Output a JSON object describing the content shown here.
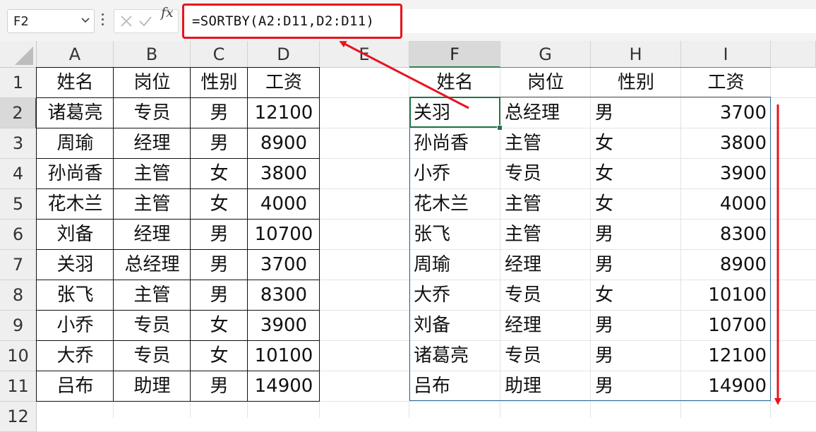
{
  "formula_bar": {
    "name_box": "F2",
    "fx_label": "fx",
    "formula": "=SORTBY(A2:D11,D2:D11)"
  },
  "columns": [
    "A",
    "B",
    "C",
    "D",
    "E",
    "F",
    "G",
    "H",
    "I"
  ],
  "rows": [
    "1",
    "2",
    "3",
    "4",
    "5",
    "6",
    "7",
    "8",
    "9",
    "10",
    "11",
    "12"
  ],
  "source_table": {
    "headers": [
      "姓名",
      "岗位",
      "性别",
      "工资"
    ],
    "rows": [
      [
        "诸葛亮",
        "专员",
        "男",
        "12100"
      ],
      [
        "周瑜",
        "经理",
        "男",
        "8900"
      ],
      [
        "孙尚香",
        "主管",
        "女",
        "3800"
      ],
      [
        "花木兰",
        "主管",
        "女",
        "4000"
      ],
      [
        "刘备",
        "经理",
        "男",
        "10700"
      ],
      [
        "关羽",
        "总经理",
        "男",
        "3700"
      ],
      [
        "张飞",
        "主管",
        "男",
        "8300"
      ],
      [
        "小乔",
        "专员",
        "女",
        "3900"
      ],
      [
        "大乔",
        "专员",
        "女",
        "10100"
      ],
      [
        "吕布",
        "助理",
        "男",
        "14900"
      ]
    ]
  },
  "sorted_table": {
    "headers": [
      "姓名",
      "岗位",
      "性别",
      "工资"
    ],
    "rows": [
      [
        "关羽",
        "总经理",
        "男",
        "3700"
      ],
      [
        "孙尚香",
        "主管",
        "女",
        "3800"
      ],
      [
        "小乔",
        "专员",
        "女",
        "3900"
      ],
      [
        "花木兰",
        "主管",
        "女",
        "4000"
      ],
      [
        "张飞",
        "主管",
        "男",
        "8300"
      ],
      [
        "周瑜",
        "经理",
        "男",
        "8900"
      ],
      [
        "大乔",
        "专员",
        "女",
        "10100"
      ],
      [
        "刘备",
        "经理",
        "男",
        "10700"
      ],
      [
        "诸葛亮",
        "专员",
        "男",
        "12100"
      ],
      [
        "吕布",
        "助理",
        "男",
        "14900"
      ]
    ]
  },
  "colors": {
    "annotation_red": "#e8131f",
    "selection_green": "#217346",
    "spill_border_blue": "#2f6b9c"
  },
  "icons": [
    "chevron-down-icon",
    "more-options-icon",
    "cancel-icon",
    "confirm-icon",
    "function-icon"
  ]
}
